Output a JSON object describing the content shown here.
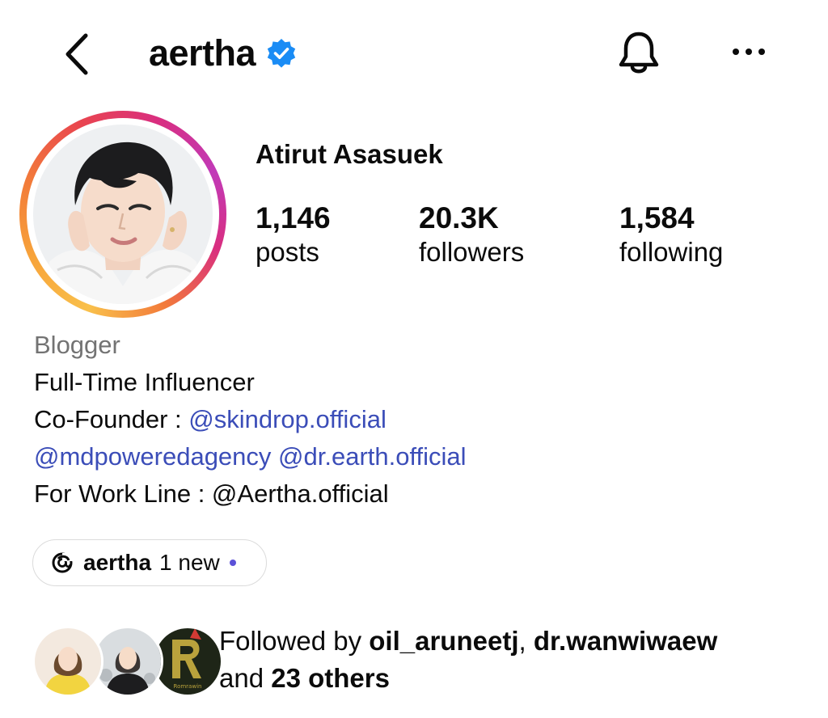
{
  "header": {
    "username": "aertha",
    "verified": true,
    "icons": [
      "chevron-left-icon",
      "verified-badge-icon",
      "bell-icon",
      "more-horizontal-icon"
    ]
  },
  "profile": {
    "full_name": "Atirut Asasuek",
    "stats": [
      {
        "value": "1,146",
        "label": "posts"
      },
      {
        "value": "20.3K",
        "label": "followers"
      },
      {
        "value": "1,584",
        "label": "following"
      }
    ]
  },
  "bio": {
    "category": "Blogger",
    "line1": "Full-Time Influencer",
    "cofounder_prefix": "Co-Founder : ",
    "mention_skindrop": "@skindrop.official",
    "mention_mdpowered": "@mdpoweredagency",
    "mention_drearth": "@dr.earth.official",
    "work_line": "For Work Line : @Aertha.official"
  },
  "threads": {
    "icon": "threads-icon",
    "name": "aertha",
    "new_label": "1 new"
  },
  "followed_by": {
    "prefix": "Followed by ",
    "user1": "oil_aruneetj",
    "separator": ", ",
    "user2": "dr.wanwiwaew",
    "middle": "and ",
    "others": "23 others",
    "avatar3_letter": "R",
    "avatar3_caption": "Romrawin"
  },
  "colors": {
    "link": "#3b4db8",
    "verified": "#1a8cf5",
    "category": "#737373",
    "threads_dot": "#5b51d8"
  }
}
